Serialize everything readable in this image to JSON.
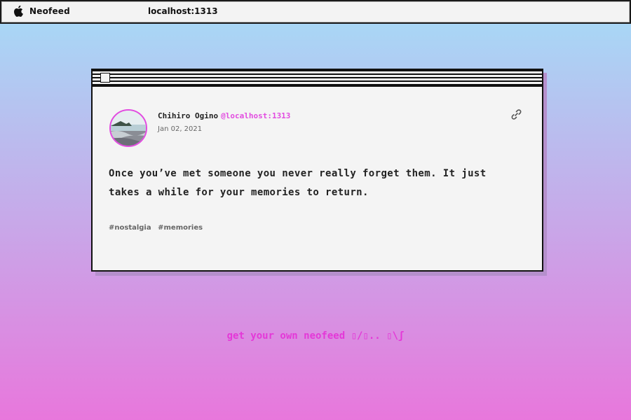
{
  "menubar": {
    "apple_icon": "apple-icon",
    "app_name": "Neofeed",
    "url": "localhost:1313"
  },
  "post": {
    "author": {
      "name": "Chihiro Ogino",
      "handle": "@localhost:1313",
      "avatar": "beach-landscape-photo"
    },
    "date": "Jan 02, 2021",
    "permalink_icon": "link-icon",
    "body": "Once you’ve met someone you never really forget them. It just takes a while for your memories to return.",
    "tags": [
      "#nostalgia",
      "#memories"
    ]
  },
  "footer": {
    "cta": "get your own neofeed ▯/▯.. ▯\\ʃ"
  },
  "colors": {
    "accent": "#e24be0",
    "gradient_top": "#a5dcf7",
    "gradient_bottom": "#e877dc"
  }
}
